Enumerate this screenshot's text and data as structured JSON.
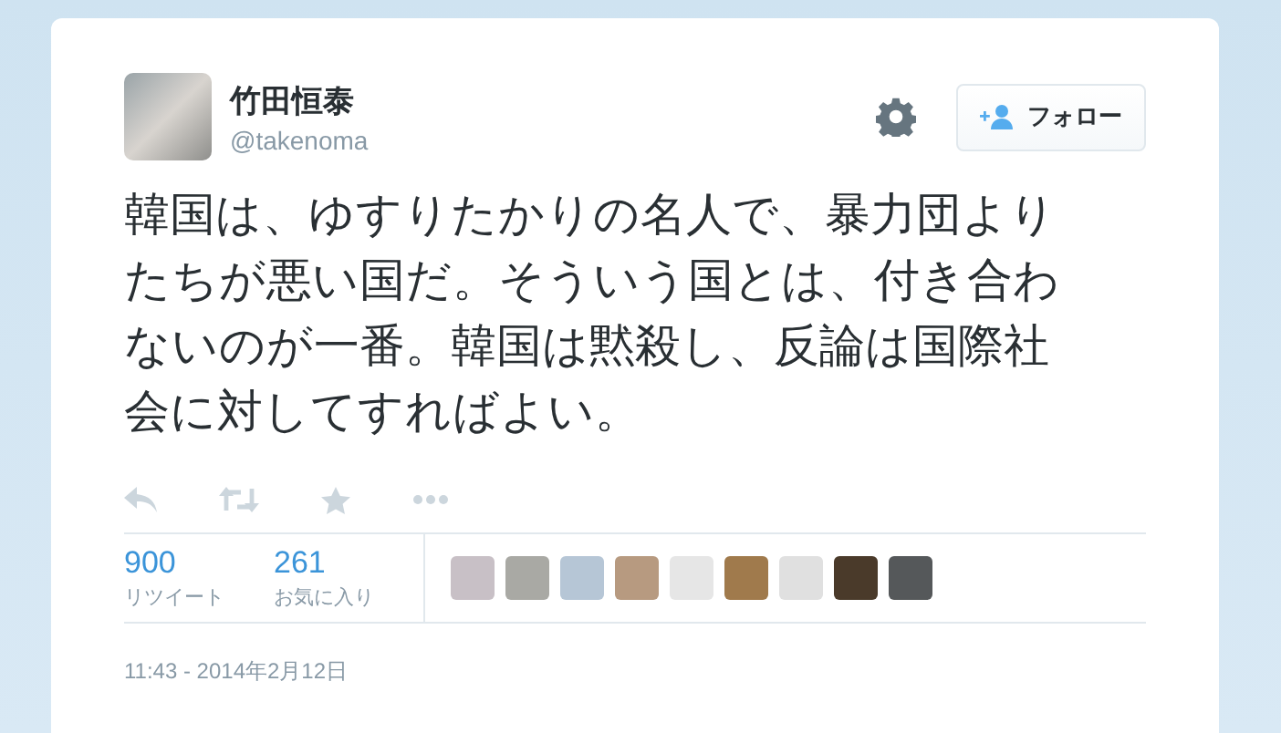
{
  "tweet": {
    "name": "竹田恒泰",
    "handle": "@takenoma",
    "follow_button": "フォロー",
    "text": "韓国は、ゆすりたかりの名人で、暴力団よりたちが悪い国だ。そういう国とは、付き合わないのが一番。韓国は黙殺し、反論は国際社会に対してすればよい。",
    "stats": [
      {
        "count": "900",
        "label": "リツイート"
      },
      {
        "count": "261",
        "label": "お気に入り"
      }
    ],
    "timestamp": "11:43 - 2014年2月12日"
  }
}
